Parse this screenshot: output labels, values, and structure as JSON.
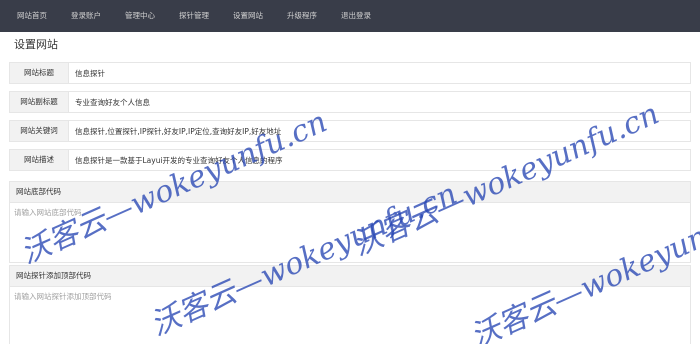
{
  "nav": {
    "items": [
      {
        "label": "网站首页"
      },
      {
        "label": "登录账户"
      },
      {
        "label": "管理中心"
      },
      {
        "label": "探针管理"
      },
      {
        "label": "设置网站"
      },
      {
        "label": "升级程序"
      },
      {
        "label": "退出登录"
      }
    ]
  },
  "page": {
    "title": "设置网站"
  },
  "form": {
    "site_title": {
      "label": "网站标题",
      "value": "信息探针"
    },
    "site_subtitle": {
      "label": "网站副标题",
      "value": "专业查询好友个人信息"
    },
    "site_keywords": {
      "label": "网站关键词",
      "value": "信息探针,位置探针,IP探针,好友IP,IP定位,查询好友IP,好友地址"
    },
    "site_description": {
      "label": "网站描述",
      "value": "信息探针是一款基于Layui开发的专业查询好友个人信息的程序"
    },
    "footer_code": {
      "label": "网站底部代码",
      "placeholder": "请输入网站底部代码"
    },
    "probe_top_code": {
      "label": "网站探针添加顶部代码",
      "placeholder": "请输入网站探针添加顶部代码"
    }
  },
  "watermark": {
    "text": "沃客云—wokeyunfu.cn",
    "color": "#2846b4"
  }
}
